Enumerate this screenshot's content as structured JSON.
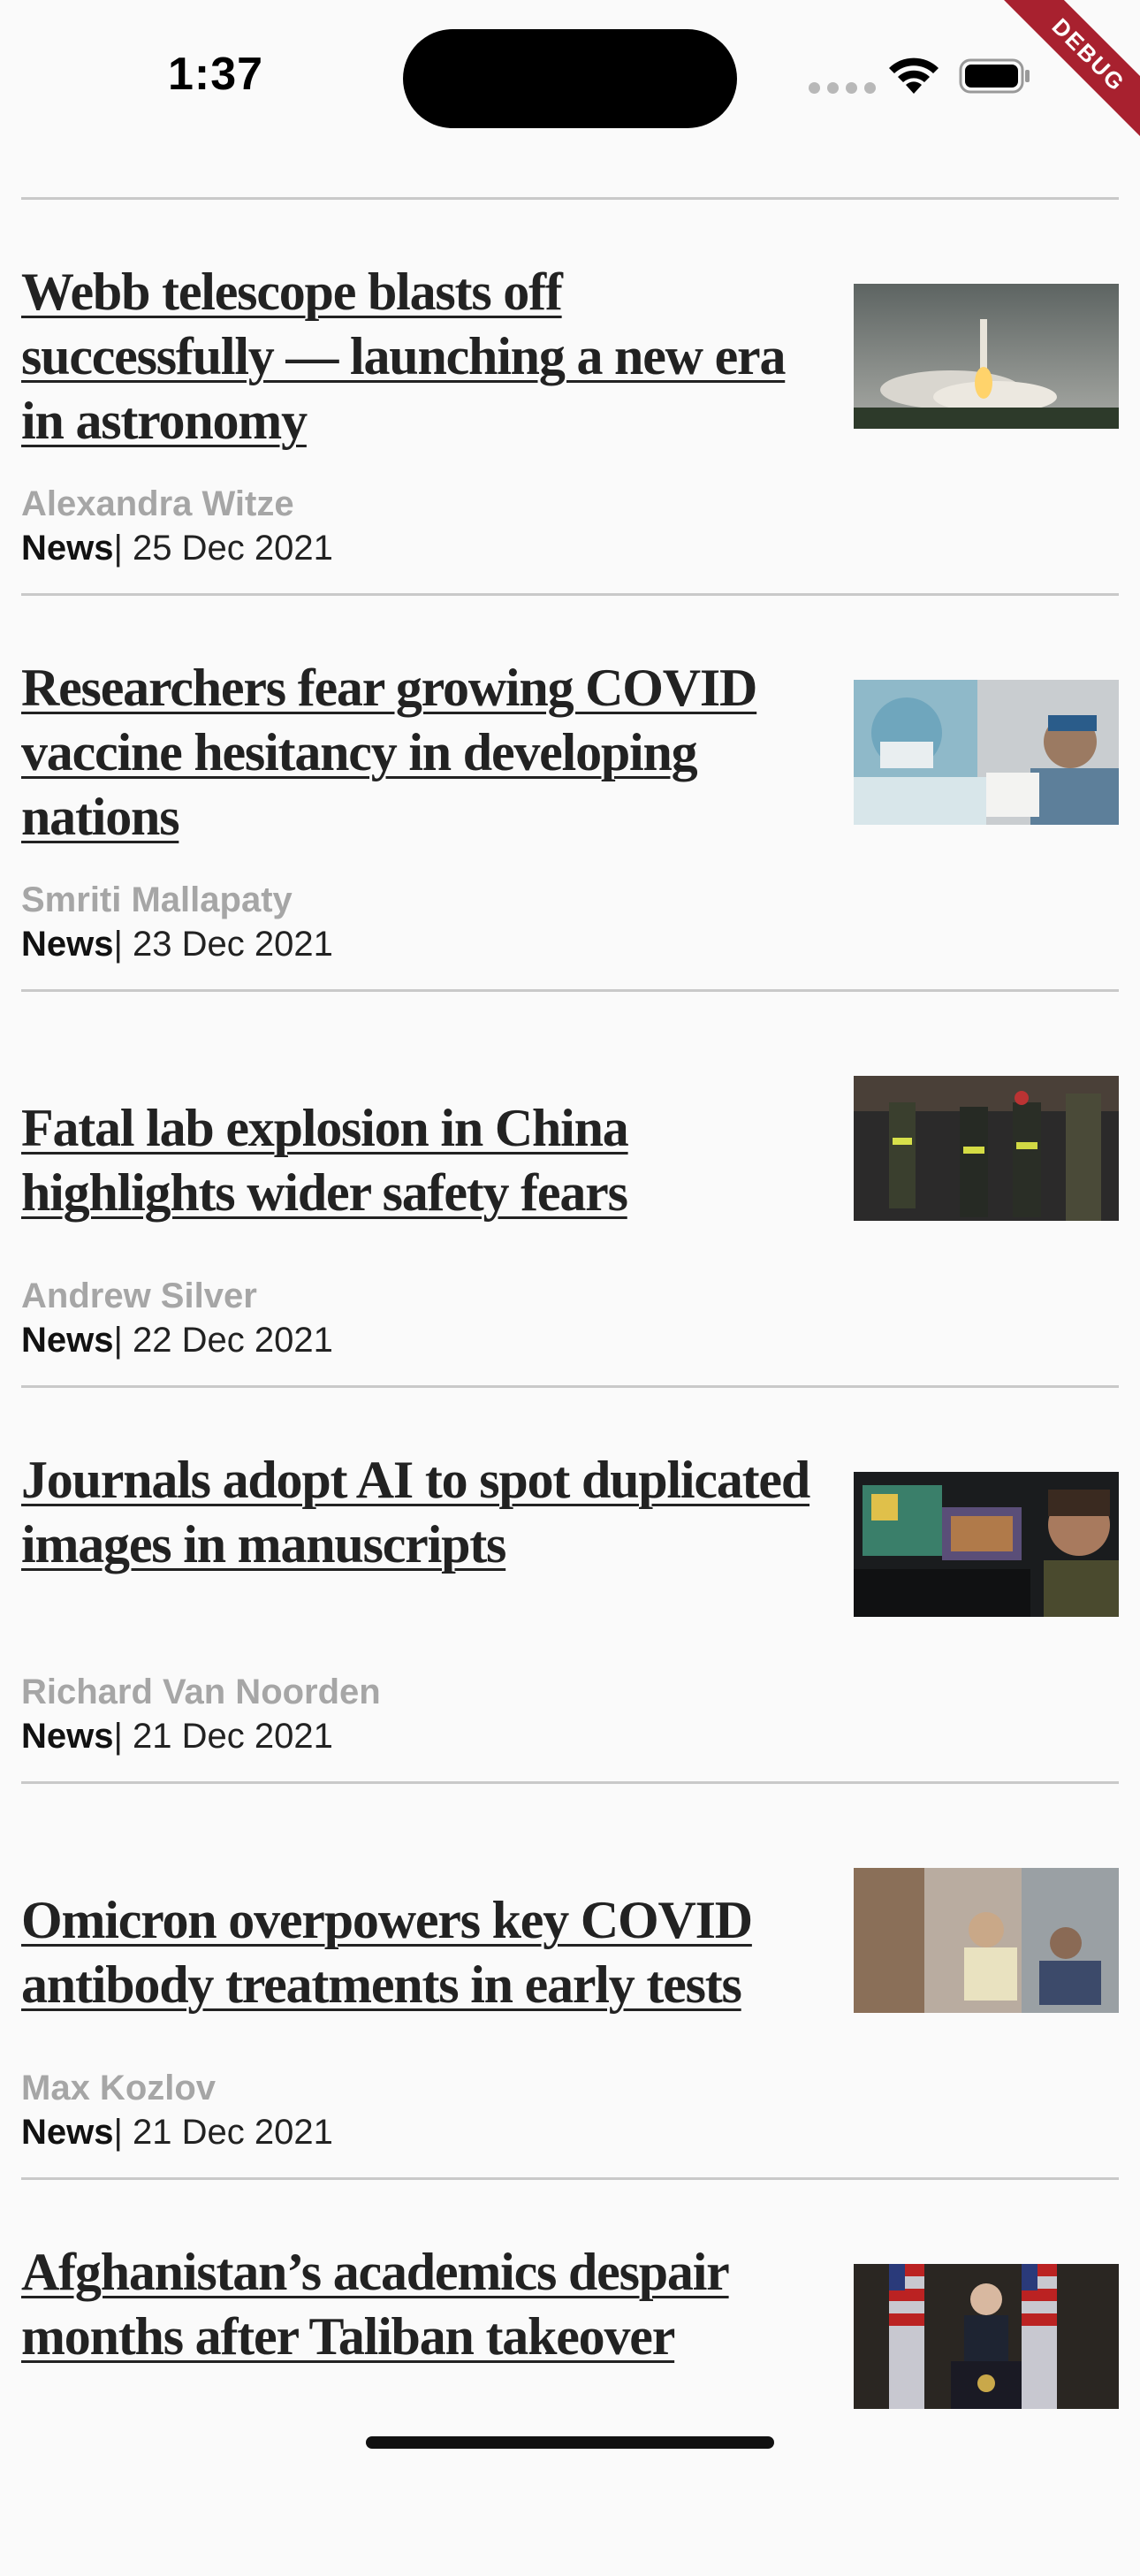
{
  "status_bar": {
    "time": "1:37",
    "debug_label": "DEBUG"
  },
  "articles": [
    {
      "title": "Webb telescope blasts off successfully — launching a new era in astronomy",
      "author": "Alexandra Witze",
      "category": "News",
      "date": "| 25 Dec 2021",
      "image": "rocket-launch-image"
    },
    {
      "title": "Researchers fear growing COVID vaccine hesitancy in developing nations",
      "author": "Smriti Mallapaty",
      "category": "News",
      "date": "| 23 Dec 2021",
      "image": "vaccination-image"
    },
    {
      "title": "Fatal lab explosion in China highlights wider safety fears",
      "author": "Andrew Silver",
      "category": "News",
      "date": "| 22 Dec 2021",
      "image": "firefighters-image"
    },
    {
      "title": "Journals adopt AI to spot duplicated images in manuscripts",
      "author": "Richard Van Noorden",
      "category": "News",
      "date": "| 21 Dec 2021",
      "image": "monitors-image"
    },
    {
      "title": "Omicron overpowers key COVID antibody treatments in early tests",
      "author": "Max Kozlov",
      "category": "News",
      "date": "| 21 Dec 2021",
      "image": "hospital-treatment-image"
    },
    {
      "title": "Afghanistan’s academics despair months after Taliban takeover",
      "image": "press-conference-image"
    }
  ]
}
